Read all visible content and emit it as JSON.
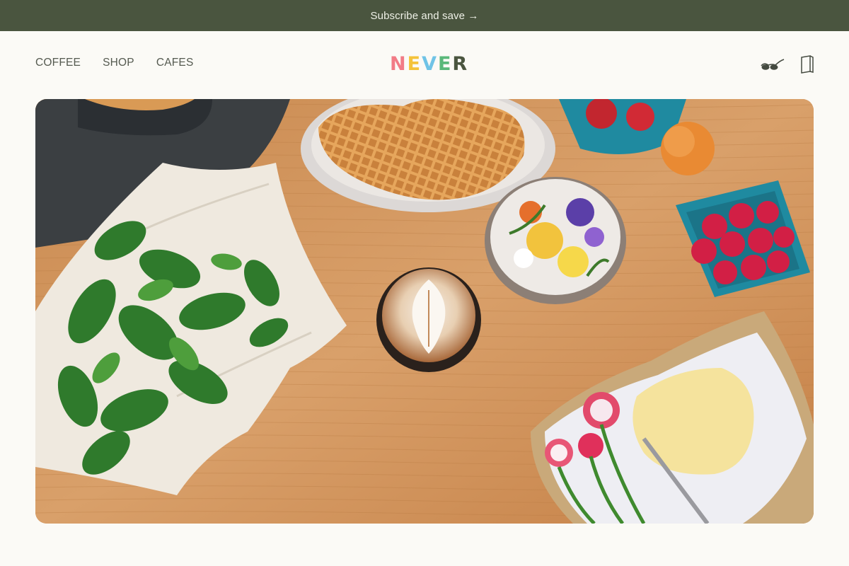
{
  "announcement": {
    "text": "Subscribe and save →"
  },
  "nav": {
    "items": [
      {
        "label": "COFFEE"
      },
      {
        "label": "SHOP"
      },
      {
        "label": "CAFES"
      }
    ]
  },
  "brand": {
    "letters": [
      "N",
      "E",
      "V",
      "E",
      "R"
    ],
    "colors": [
      "#f27b86",
      "#f4c33a",
      "#6fc3e6",
      "#5ab87a",
      "#4a553f"
    ]
  },
  "header_icons": [
    "glasses-icon",
    "bag-icon"
  ],
  "colors": {
    "announcement_bg": "#4a553f",
    "page_bg": "#fbfaf6",
    "nav_text": "#555a50"
  },
  "hero": {
    "alt": "Breakfast spread with waffles, latte, edible flowers, raspberries, butter and radishes on a wooden table"
  }
}
